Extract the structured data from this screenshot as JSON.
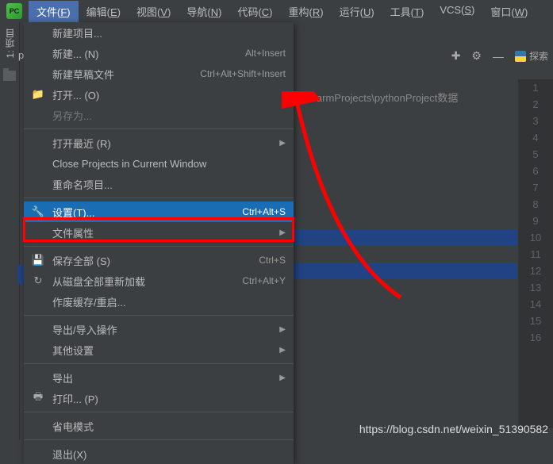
{
  "menubar": {
    "items": [
      {
        "label": "文件(F)",
        "mn": "F"
      },
      {
        "label": "编辑(E)",
        "mn": "E"
      },
      {
        "label": "视图(V)",
        "mn": "V"
      },
      {
        "label": "导航(N)",
        "mn": "N"
      },
      {
        "label": "代码(C)",
        "mn": "C"
      },
      {
        "label": "重构(R)",
        "mn": "R"
      },
      {
        "label": "运行(U)",
        "mn": "U"
      },
      {
        "label": "工具(T)",
        "mn": "T"
      },
      {
        "label": "VCS(S)",
        "mn": "S"
      },
      {
        "label": "窗口(W)",
        "mn": "W"
      }
    ],
    "active_index": 0
  },
  "sidebar": {
    "label": "1: 项目",
    "project_prefix": "py"
  },
  "dropdown": {
    "items": [
      {
        "label": "新建项目...",
        "shortcut": "",
        "icon": "",
        "sub": false
      },
      {
        "label": "新建... (N)",
        "shortcut": "Alt+Insert",
        "icon": "",
        "sub": false
      },
      {
        "label": "新建草稿文件",
        "shortcut": "Ctrl+Alt+Shift+Insert",
        "icon": "",
        "sub": false
      },
      {
        "label": "打开... (O)",
        "shortcut": "",
        "icon": "folder",
        "sub": false
      },
      {
        "label": "另存为...",
        "shortcut": "",
        "icon": "",
        "sub": false,
        "disabled": true
      },
      {
        "label": "打开最近 (R)",
        "shortcut": "",
        "icon": "",
        "sub": true,
        "sep_before": true
      },
      {
        "label": "Close Projects in Current Window",
        "shortcut": "",
        "icon": "",
        "sub": false
      },
      {
        "label": "重命名项目...",
        "shortcut": "",
        "icon": "",
        "sub": false
      },
      {
        "label": "设置(T)...",
        "shortcut": "Ctrl+Alt+S",
        "icon": "wrench",
        "sub": false,
        "highlighted": true,
        "sep_before": true
      },
      {
        "label": "文件属性",
        "shortcut": "",
        "icon": "",
        "sub": true
      },
      {
        "label": "保存全部 (S)",
        "shortcut": "Ctrl+S",
        "icon": "save",
        "sub": false,
        "sep_before": true
      },
      {
        "label": "从磁盘全部重新加载",
        "shortcut": "Ctrl+Alt+Y",
        "icon": "reload",
        "sub": false
      },
      {
        "label": "作废缓存/重启...",
        "shortcut": "",
        "icon": "",
        "sub": false
      },
      {
        "label": "导出/导入操作",
        "shortcut": "",
        "icon": "",
        "sub": true,
        "sep_before": true
      },
      {
        "label": "其他设置",
        "shortcut": "",
        "icon": "",
        "sub": true
      },
      {
        "label": "导出",
        "shortcut": "",
        "icon": "",
        "sub": true,
        "sep_before": true
      },
      {
        "label": "打印... (P)",
        "shortcut": "",
        "icon": "print",
        "sub": false
      },
      {
        "label": "省电模式",
        "shortcut": "",
        "icon": "",
        "sub": false,
        "sep_before": true
      },
      {
        "label": "退出(X)",
        "shortcut": "",
        "icon": "",
        "sub": false,
        "sep_before": true
      }
    ]
  },
  "toolbar": {
    "explore_label": "探索"
  },
  "breadcrumb": {
    "path": "PycharmProjects\\pythonProject数据"
  },
  "gutter": {
    "lines": [
      "1",
      "2",
      "3",
      "4",
      "5",
      "6",
      "7",
      "8",
      "9",
      "10",
      "11",
      "12",
      "13",
      "14",
      "15",
      "16"
    ]
  },
  "watermark": "https://blog.csdn.net/weixin_51390582"
}
